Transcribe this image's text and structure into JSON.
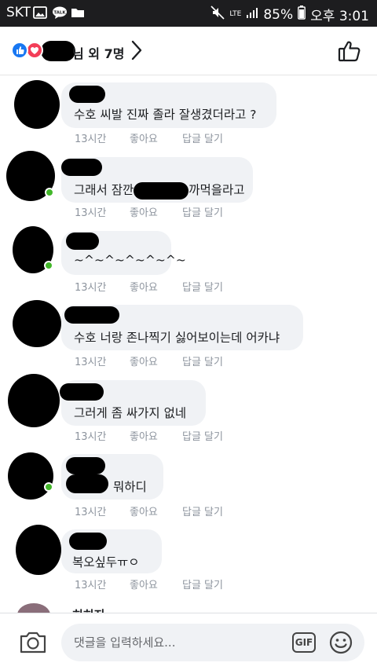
{
  "status_bar": {
    "carrier": "SKT",
    "network": "LTE",
    "battery": "85%",
    "time": "오후 3:01",
    "icons": [
      "image-icon",
      "talk-icon",
      "folder-icon",
      "mute-icon",
      "signal-icon",
      "battery-icon"
    ]
  },
  "header": {
    "reactors_text": "님 외 7명",
    "reaction_icons": [
      "like-reaction-icon",
      "love-reaction-icon"
    ]
  },
  "comments": [
    {
      "text": "수호 씨발 진짜 졸라 잘생겼더라고 ?",
      "time": "13시간",
      "like": "좋아요",
      "reply": "답글 달기"
    },
    {
      "text_before": "그래서 잠깐",
      "text_after": "까먹을라고",
      "time": "13시간",
      "like": "좋아요",
      "reply": "답글 달기"
    },
    {
      "text": "~^~^~^~^~^~",
      "time": "13시간",
      "like": "좋아요",
      "reply": "답글 달기"
    },
    {
      "text": "수호 너랑 존나찍기 싫어보이는데 어카냐",
      "time": "13시간",
      "like": "좋아요",
      "reply": "답글 달기"
    },
    {
      "text": "그러게 좀 싸가지 없네",
      "time": "13시간",
      "like": "좋아요",
      "reply": "답글 달기"
    },
    {
      "text": "뭐하디",
      "time": "13시간",
      "like": "좋아요",
      "reply": "답글 달기"
    },
    {
      "text": "복오싶두ㅠㅇ",
      "time": "13시간",
      "like": "좋아요",
      "reply": "답글 달기"
    }
  ],
  "partial_comment": {
    "text": "히히지"
  },
  "composer": {
    "placeholder": "댓글을 입력하세요...",
    "gif_label": "GIF"
  },
  "colors": {
    "status_bar_bg": "#1d1d1f",
    "bubble_bg": "#f0f2f5",
    "like_blue": "#1877f2",
    "love_red": "#f33e58",
    "online_green": "#42b72a",
    "meta_gray": "#8d949e"
  }
}
